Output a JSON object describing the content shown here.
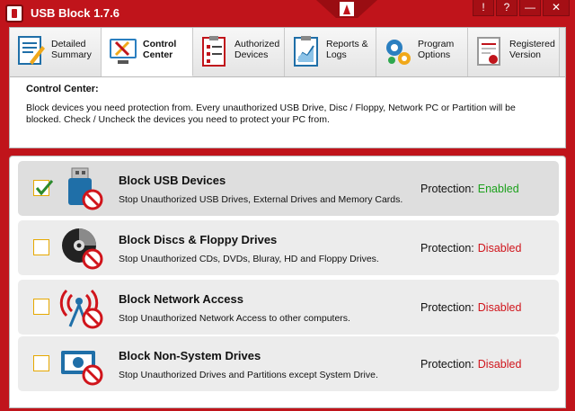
{
  "app": {
    "title": "USB Block 1.7.6"
  },
  "window_controls": {
    "help": "!",
    "about": "?",
    "minimize": "—",
    "close": "✕"
  },
  "tabs": [
    {
      "label": "Detailed Summary",
      "icon": "summary-icon",
      "active": false
    },
    {
      "label": "Control Center",
      "icon": "tools-icon",
      "active": true
    },
    {
      "label": "Authorized Devices",
      "icon": "checklist-icon",
      "active": false
    },
    {
      "label": "Reports & Logs",
      "icon": "report-chart-icon",
      "active": false
    },
    {
      "label": "Program Options",
      "icon": "gears-icon",
      "active": false
    },
    {
      "label": "Registered Version",
      "icon": "certificate-icon",
      "active": false
    }
  ],
  "description": {
    "title": "Control Center:",
    "text": "Block devices you need protection from. Every unauthorized USB Drive, Disc / Floppy, Network PC or Partition will be blocked. Check / Uncheck the devices you need to protect your PC from."
  },
  "protection_label": "Protection:",
  "devices": [
    {
      "title": "Block USB Devices",
      "subtitle": "Stop Unauthorized USB Drives, External Drives and Memory Cards.",
      "checked": true,
      "status": "Enabled",
      "icon": "usb-drive-icon"
    },
    {
      "title": "Block Discs & Floppy Drives",
      "subtitle": "Stop Unauthorized CDs, DVDs, Bluray, HD and Floppy Drives.",
      "checked": false,
      "status": "Disabled",
      "icon": "disc-icon"
    },
    {
      "title": "Block Network Access",
      "subtitle": "Stop Unauthorized Network Access to other computers.",
      "checked": false,
      "status": "Disabled",
      "icon": "network-antenna-icon"
    },
    {
      "title": "Block Non-System Drives",
      "subtitle": "Stop Unauthorized Drives and Partitions except System Drive.",
      "checked": false,
      "status": "Disabled",
      "icon": "hard-drive-icon"
    }
  ],
  "colors": {
    "brand": "#c0141b",
    "enabled": "#1ca11c",
    "disabled": "#d0141b",
    "checkbox_border": "#e6a800"
  }
}
